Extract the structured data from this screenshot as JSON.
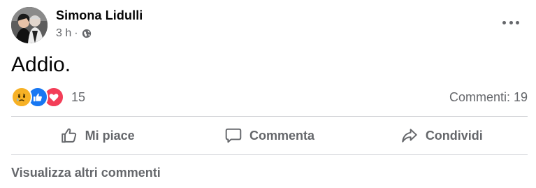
{
  "post": {
    "author": "Simona Lidulli",
    "time": "3 h",
    "separator": "·",
    "privacy_icon": "globe-icon",
    "text": "Addio.",
    "reactions": {
      "icons": [
        "sad-reaction-icon",
        "like-reaction-icon",
        "love-reaction-icon"
      ],
      "count": "15"
    },
    "comments": "Commenti: 19"
  },
  "actions": {
    "like": "Mi piace",
    "comment": "Commenta",
    "share": "Condividi"
  },
  "view_more_comments": "Visualizza altri commenti",
  "colors": {
    "secondary_text": "#65676b",
    "divider": "#ced0d4",
    "like_blue": "#1877f2",
    "love_red": "#f33e58",
    "sad_yellow": "#f7b125"
  }
}
